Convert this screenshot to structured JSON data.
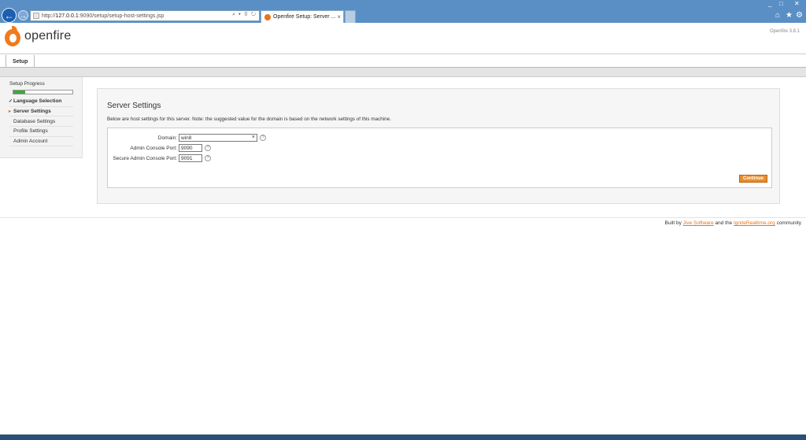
{
  "browser": {
    "url_prefix": "http://",
    "url_host": "127.0.0.1",
    "url_path": ":9090/setup/setup-host-settings.jsp",
    "address_tools": "⌕ ▾ ▯ ↻",
    "tab_title": "Openfire Setup: Server ...",
    "tab_close": "×",
    "back_glyph": "←",
    "forward_glyph": "→",
    "min_glyph": "_",
    "max_glyph": "□",
    "close_glyph": "✕",
    "home_glyph": "⌂",
    "star_glyph": "★",
    "gear_glyph": "⚙"
  },
  "header": {
    "logo_text": "openfire",
    "version": "Openfire 3.8.1"
  },
  "tabbar": {
    "setup_tab": "Setup"
  },
  "sidebar": {
    "title": "Setup Progress",
    "progress": 0.2,
    "steps": [
      {
        "label": "Language Selection",
        "mark": "✓"
      },
      {
        "label": "Server Settings",
        "mark": "▸"
      },
      {
        "label": "Database Settings",
        "mark": ""
      },
      {
        "label": "Profile Settings",
        "mark": ""
      },
      {
        "label": "Admin Account",
        "mark": ""
      }
    ]
  },
  "main": {
    "title": "Server Settings",
    "description": "Below are host settings for this server. Note: the suggested value for the domain is based on the network settings of this machine.",
    "fields": {
      "domain_label": "Domain:",
      "domain_value": "win8",
      "domain_clear": "×",
      "admin_port_label": "Admin Console Port:",
      "admin_port_value": "9090",
      "secure_port_label": "Secure Admin Console Port:",
      "secure_port_value": "9091",
      "help_glyph": "?"
    },
    "continue_label": "Continue"
  },
  "footer": {
    "prefix": "Built by ",
    "jive_link": "Jive Software",
    "middle": " and the ",
    "ignite_link": "IgniteRealtime.org",
    "suffix": " community"
  }
}
